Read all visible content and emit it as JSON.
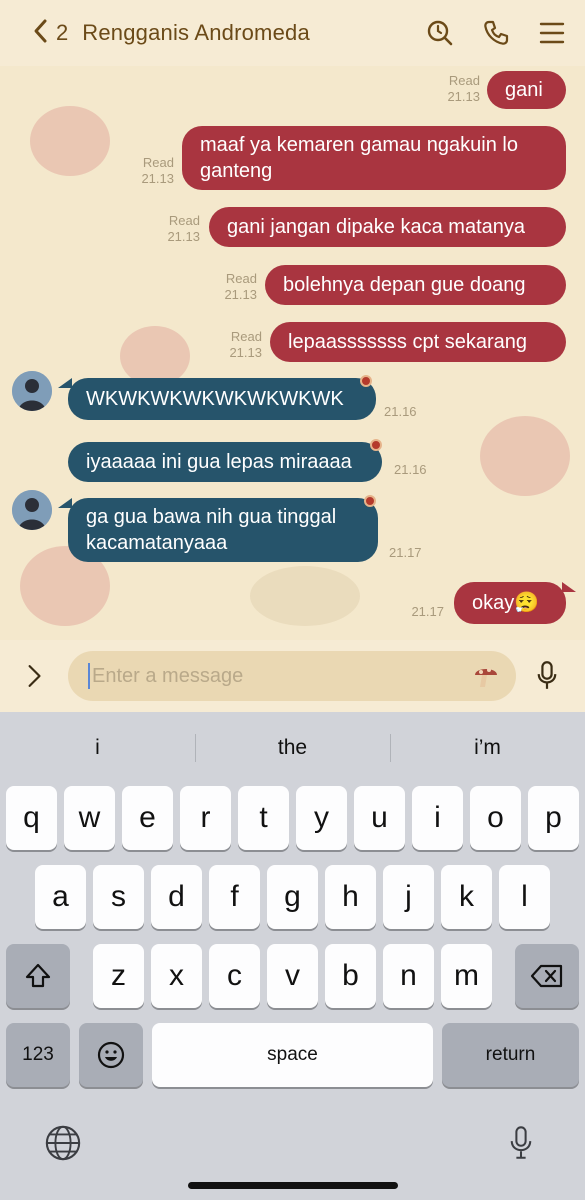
{
  "header": {
    "back_count": "2",
    "title": "Rengganis Andromeda",
    "icons": [
      "chevron-left-icon",
      "clock-search-icon",
      "phone-icon",
      "menu-icon"
    ]
  },
  "messages": [
    {
      "side": "out",
      "text": "gani",
      "status": "Read",
      "time": "21.13"
    },
    {
      "side": "out",
      "text": "maaf ya kemaren gamau ngakuin lo ganteng",
      "status": "Read",
      "time": "21.13"
    },
    {
      "side": "out",
      "text": "gani jangan dipake kaca matanya",
      "status": "Read",
      "time": "21.13"
    },
    {
      "side": "out",
      "text": "bolehnya depan gue doang",
      "status": "Read",
      "time": "21.13"
    },
    {
      "side": "out",
      "text": "lepaasssssss cpt sekarang",
      "status": "Read",
      "time": "21.13"
    },
    {
      "side": "in",
      "text": "WKWKWKWKWKWKWKWK",
      "time": "21.16"
    },
    {
      "side": "in",
      "text": "iyaaaaa ini gua lepas miraaaa",
      "time": "21.16"
    },
    {
      "side": "in",
      "text": "ga gua bawa nih gua tinggal kacamatanyaaa",
      "time": "21.17"
    },
    {
      "side": "out",
      "text": "okay😮‍💨",
      "time": "21.17"
    }
  ],
  "input": {
    "placeholder": "Enter a message",
    "value": ""
  },
  "keyboard": {
    "suggestions": [
      "i",
      "the",
      "i’m"
    ],
    "row1": [
      "q",
      "w",
      "e",
      "r",
      "t",
      "y",
      "u",
      "i",
      "o",
      "p"
    ],
    "row2": [
      "a",
      "s",
      "d",
      "f",
      "g",
      "h",
      "j",
      "k",
      "l"
    ],
    "row3": [
      "z",
      "x",
      "c",
      "v",
      "b",
      "n",
      "m"
    ],
    "numbers_label": "123",
    "space_label": "space",
    "return_label": "return"
  },
  "colors": {
    "outgoing_bubble": "#a93540",
    "incoming_bubble": "#26546b",
    "chat_background": "#f4e8cc",
    "header_text": "#6b4a18"
  }
}
